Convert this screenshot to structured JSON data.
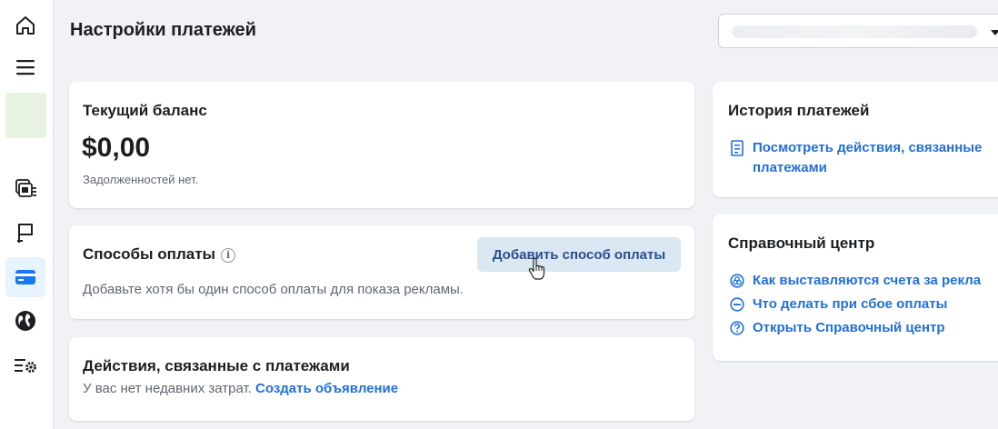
{
  "sidebar": {
    "items": [
      {
        "name": "home",
        "icon": "home-icon"
      },
      {
        "name": "menu",
        "icon": "hamburger-menu-icon"
      },
      {
        "name": "ads",
        "icon": "ads-stack-icon"
      },
      {
        "name": "pages",
        "icon": "flag-icon"
      },
      {
        "name": "billing",
        "icon": "credit-card-icon",
        "active": true
      },
      {
        "name": "global",
        "icon": "globe-icon"
      },
      {
        "name": "settings",
        "icon": "settings-list-icon"
      }
    ]
  },
  "header": {
    "title": "Настройки платежей"
  },
  "balance_card": {
    "title": "Текущий баланс",
    "amount": "$0,00",
    "note": "Задолженностей нет."
  },
  "payment_methods_card": {
    "title": "Способы оплаты",
    "info_glyph": "i",
    "add_button_label": "Добавить способ оплаты",
    "description": "Добавьте хотя бы один способ оплаты для показа рекламы."
  },
  "activity_card": {
    "title": "Действия, связанные с платежами",
    "text": "У вас нет недавних затрат.",
    "link": "Создать объявление"
  },
  "history_card": {
    "title": "История платежей",
    "link_line1": "Посмотреть действия, связанные",
    "link_line2": "платежами"
  },
  "help_card": {
    "title": "Справочный центр",
    "links": [
      {
        "label": "Как выставляются счета за рекла",
        "icon": "billing-circle-icon"
      },
      {
        "label": "Что делать при сбое оплаты",
        "icon": "minus-circle-icon"
      },
      {
        "label": "Открыть Справочный центр",
        "icon": "question-circle-icon"
      }
    ]
  },
  "colors": {
    "accent": "#216fdb",
    "background": "#f0f2f5",
    "active_nav": "#1877f2",
    "button_bg": "#dbe7f2"
  }
}
